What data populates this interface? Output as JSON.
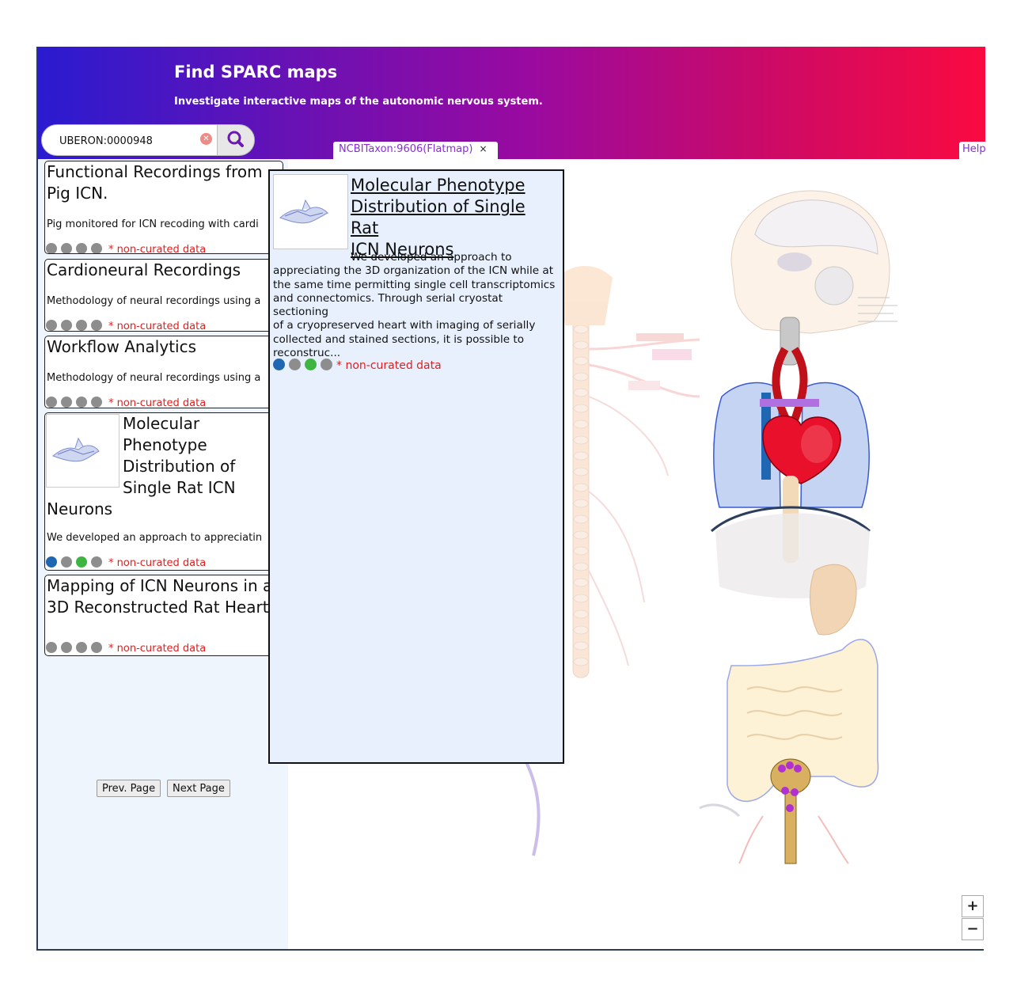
{
  "header": {
    "title": "Find SPARC maps",
    "subtitle": "Investigate interactive maps of the autonomic nervous system."
  },
  "search": {
    "value": "UBERON:0000948",
    "clear_icon": "clear-icon",
    "search_icon": "magnifier-icon"
  },
  "tabs": [
    {
      "label": "NCBITaxon:9606(Flatmap)",
      "close": "×"
    }
  ],
  "help_label": "Help",
  "cards": [
    {
      "title": "Functional Recordings from Pig ICN.",
      "desc": "Pig monitored for ICN recoding with cardi",
      "badge": "* non-curated data"
    },
    {
      "title": "Cardioneural Recordings",
      "desc": "Methodology of neural recordings using a",
      "badge": "* non-curated data"
    },
    {
      "title": "Workflow Analytics",
      "desc": "Methodology of neural recordings using a",
      "badge": "* non-curated data"
    },
    {
      "title_lines": [
        "Molecular",
        "Phenotype",
        "Distribution of",
        "Single Rat ICN",
        "Neurons"
      ],
      "desc": "We developed an approach to appreciatin",
      "badge": "* non-curated data"
    },
    {
      "title_lines": [
        "Mapping of ICN Neurons in a",
        "3D Reconstructed Rat Heart"
      ],
      "badge": "* non-curated data"
    }
  ],
  "pager": {
    "prev": "Prev. Page",
    "next": "Next Page"
  },
  "popup": {
    "title_lines": [
      "Molecular Phenotype",
      "Distribution of Single Rat",
      "ICN Neurons"
    ],
    "desc_lines": [
      "We developed an approach to",
      "appreciating the 3D organization of the ICN while at",
      "the same time permitting single cell transcriptomics",
      "and connectomics. Through serial cryostat sectioning",
      "of a cryopreserved heart with imaging of serially",
      "collected and stained sections, it is possible to",
      "reconstruc..."
    ],
    "badge": "* non-curated data"
  },
  "zoom": {
    "in": "+",
    "out": "−"
  },
  "colors": {
    "accent": "#8a2be2",
    "noncurated": "#e02020",
    "dot_blue": "#1f66b3",
    "dot_green": "#3fb541",
    "dot_grey": "#8d8d8d"
  }
}
